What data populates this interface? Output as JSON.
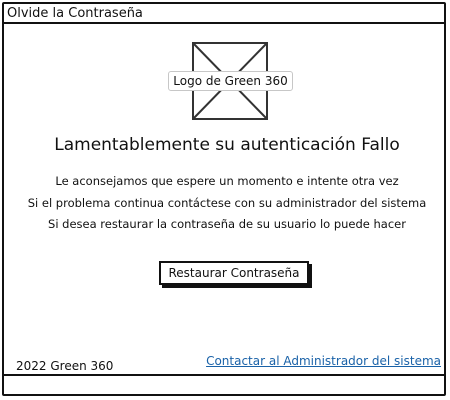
{
  "window": {
    "title": "Olvide la Contraseña"
  },
  "logo": {
    "label": "Logo de Green 360",
    "icon": "image-placeholder-icon"
  },
  "main": {
    "headline": "Lamentablemente su autenticación Fallo",
    "messages": [
      "Le aconsejamos que espere un momento e intente otra vez",
      "Si el problema continua contáctese con su administrador del sistema",
      "Si desea restaurar la contraseña de su usuario lo puede hacer"
    ],
    "restore_button": "Restaurar Contraseña"
  },
  "footer": {
    "copyright": "2022 Green 360",
    "contact_link": "Contactar al Administrador del sistema"
  },
  "colors": {
    "border": "#111111",
    "link": "#1a62a8",
    "background": "#ffffff"
  }
}
